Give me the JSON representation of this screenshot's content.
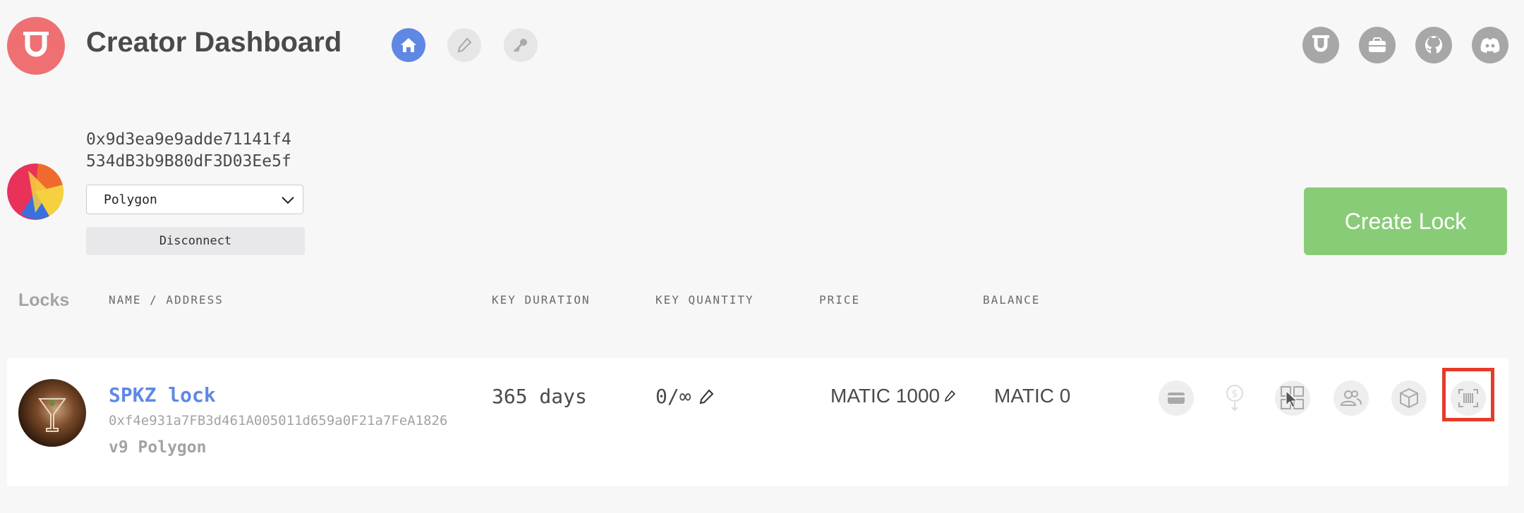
{
  "header": {
    "title": "Creator Dashboard",
    "nav": [
      "home-icon",
      "pencil-icon",
      "key-icon"
    ],
    "right_links": [
      "unlock-icon",
      "briefcase-icon",
      "github-icon",
      "discord-icon"
    ]
  },
  "account": {
    "address_line1": "0x9d3ea9e9adde71141f4",
    "address_line2": "534dB3b9B80dF3D03Ee5f",
    "network": "Polygon",
    "disconnect_label": "Disconnect"
  },
  "create_lock_label": "Create Lock",
  "locks": {
    "label": "Locks",
    "columns": [
      "NAME / ADDRESS",
      "KEY DURATION",
      "KEY QUANTITY",
      "PRICE",
      "BALANCE"
    ],
    "rows": [
      {
        "name": "SPKZ lock",
        "address": "0xf4e931a7FB3d461A005011d659a0F21a7FeA1826",
        "version": "v9 Polygon",
        "duration": "365 days",
        "quantity": "0/∞",
        "price": "MATIC 1000",
        "balance": "MATIC 0"
      }
    ]
  },
  "colors": {
    "accent": "#5f88e4",
    "brand": "#ef7073",
    "create": "#89cc77",
    "highlight": "#e53b2a"
  }
}
